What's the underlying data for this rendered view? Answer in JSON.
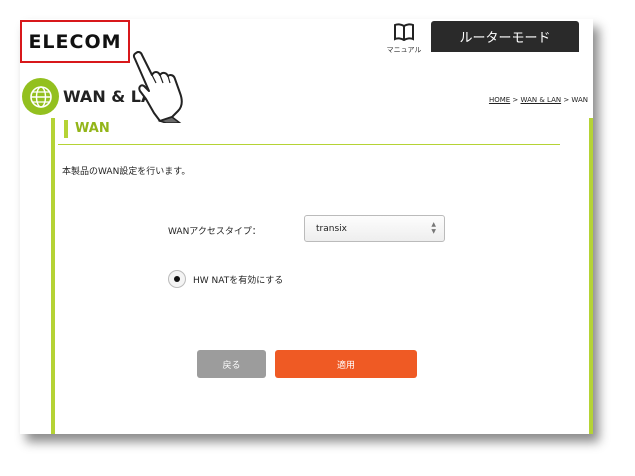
{
  "header": {
    "logo": "ELECOM",
    "manual_label": "マニュアル",
    "mode_label": "ルーターモード"
  },
  "section": {
    "title": "WAN & LAN",
    "breadcrumb": {
      "home": "HOME",
      "sep1": " > ",
      "parent": "WAN & LAN",
      "sep2": " > ",
      "current": "WAN"
    }
  },
  "panel": {
    "title": "WAN",
    "description": "本製品のWAN設定を行います。",
    "wan_type_label": "WANアクセスタイプ：",
    "wan_type_value": "transix",
    "hw_nat_label": "HW NATを有効にする",
    "hw_nat_checked": true
  },
  "buttons": {
    "back": "戻る",
    "apply": "適用"
  },
  "colors": {
    "accent_green": "#93c01f",
    "apply_orange": "#ef5a24",
    "highlight_red": "#d8181b"
  },
  "icons": {
    "manual": "book-icon",
    "section": "globe-icon",
    "pointer": "pointing-hand-icon"
  }
}
